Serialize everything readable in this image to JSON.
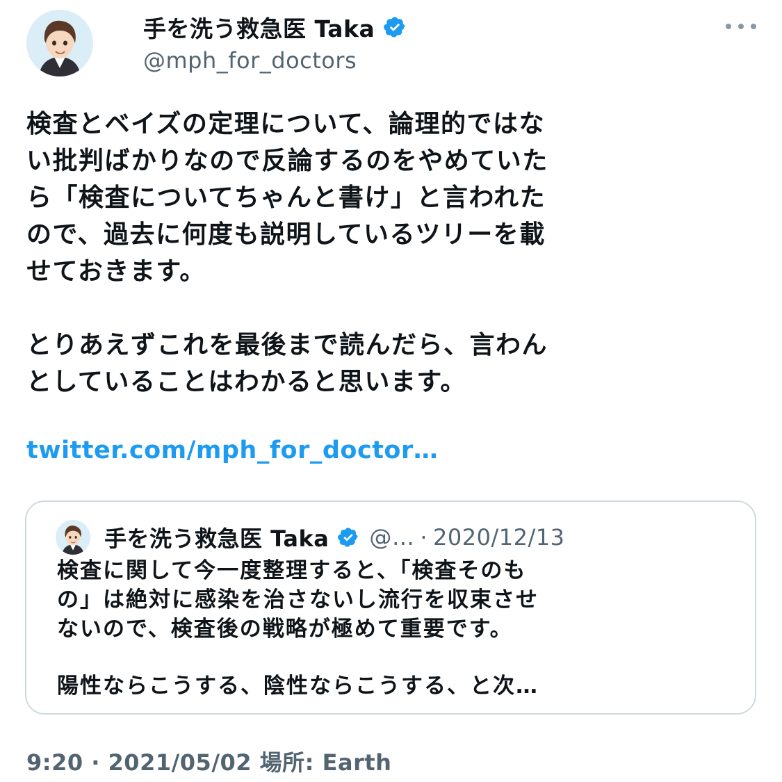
{
  "tweet": {
    "author": {
      "display_name": "手を洗う救急医 Taka",
      "handle": "@mph_for_doctors",
      "verified_icon": "verified-badge-icon",
      "avatar_icon": "avatar-illustration"
    },
    "more_icon": "more-horizontal-icon",
    "body_paragraphs": [
      [
        "検査とベイズの定理について、論理的ではな",
        "い批判ばかりなので反論するのをやめていた",
        "ら「検査についてちゃんと書け」と言われた",
        "ので、過去に何度も説明しているツリーを載",
        "せておきます。"
      ],
      [
        "とりあえずこれを最後まで読んだら、言わん",
        "としていることはわかると思います。"
      ]
    ],
    "link": "twitter.com/mph_for_doctor…",
    "quote": {
      "display_name": "手を洗う救急医 Taka",
      "handle_truncated": "@…",
      "separator": "·",
      "date": "2020/12/13",
      "text_lines": [
        "検査に関して今一度整理すると、「検査そのも",
        "の」は絶対に感染を治さないし流行を収束させ",
        "ないので、検査後の戦略が極めて重要です。"
      ],
      "text_tail": "陽性ならこうする、陰性ならこうする、と次…"
    },
    "timestamp": "9:20 · 2021/05/02 場所: Earth"
  },
  "colors": {
    "link": "#1d9bf0",
    "secondary_text": "#536471",
    "verified": "#1d9bf0",
    "border": "#cfd9de"
  }
}
